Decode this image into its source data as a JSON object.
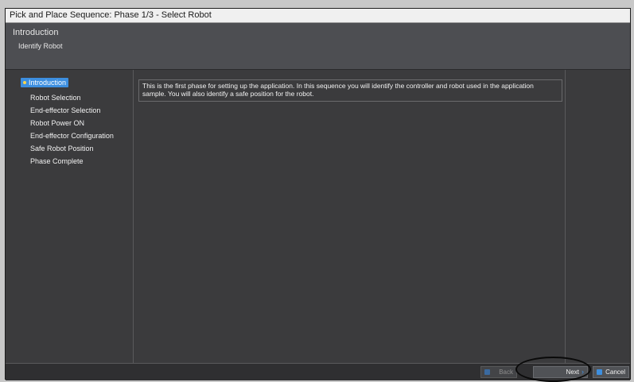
{
  "window": {
    "title": "Pick and Place Sequence: Phase 1/3 - Select Robot"
  },
  "header": {
    "title": "Introduction",
    "subtitle": "Identify Robot"
  },
  "steps": [
    {
      "label": "Introduction",
      "active": true
    },
    {
      "label": "Robot Selection",
      "active": false
    },
    {
      "label": "End-effector Selection",
      "active": false
    },
    {
      "label": "Robot Power ON",
      "active": false
    },
    {
      "label": "End-effector Configuration",
      "active": false
    },
    {
      "label": "Safe Robot Position",
      "active": false
    },
    {
      "label": "Phase Complete",
      "active": false
    }
  ],
  "content": {
    "info_text": "This is the first phase for setting up the application. In this sequence you will identify the controller and robot used in the application sample. You will also identify a safe position for the robot."
  },
  "footer": {
    "back_label": "Back",
    "next_label": "Next",
    "cancel_label": "Cancel"
  },
  "colors": {
    "accent": "#3d8fe0",
    "background": "#3b3b3d",
    "header": "#4d4e52"
  }
}
